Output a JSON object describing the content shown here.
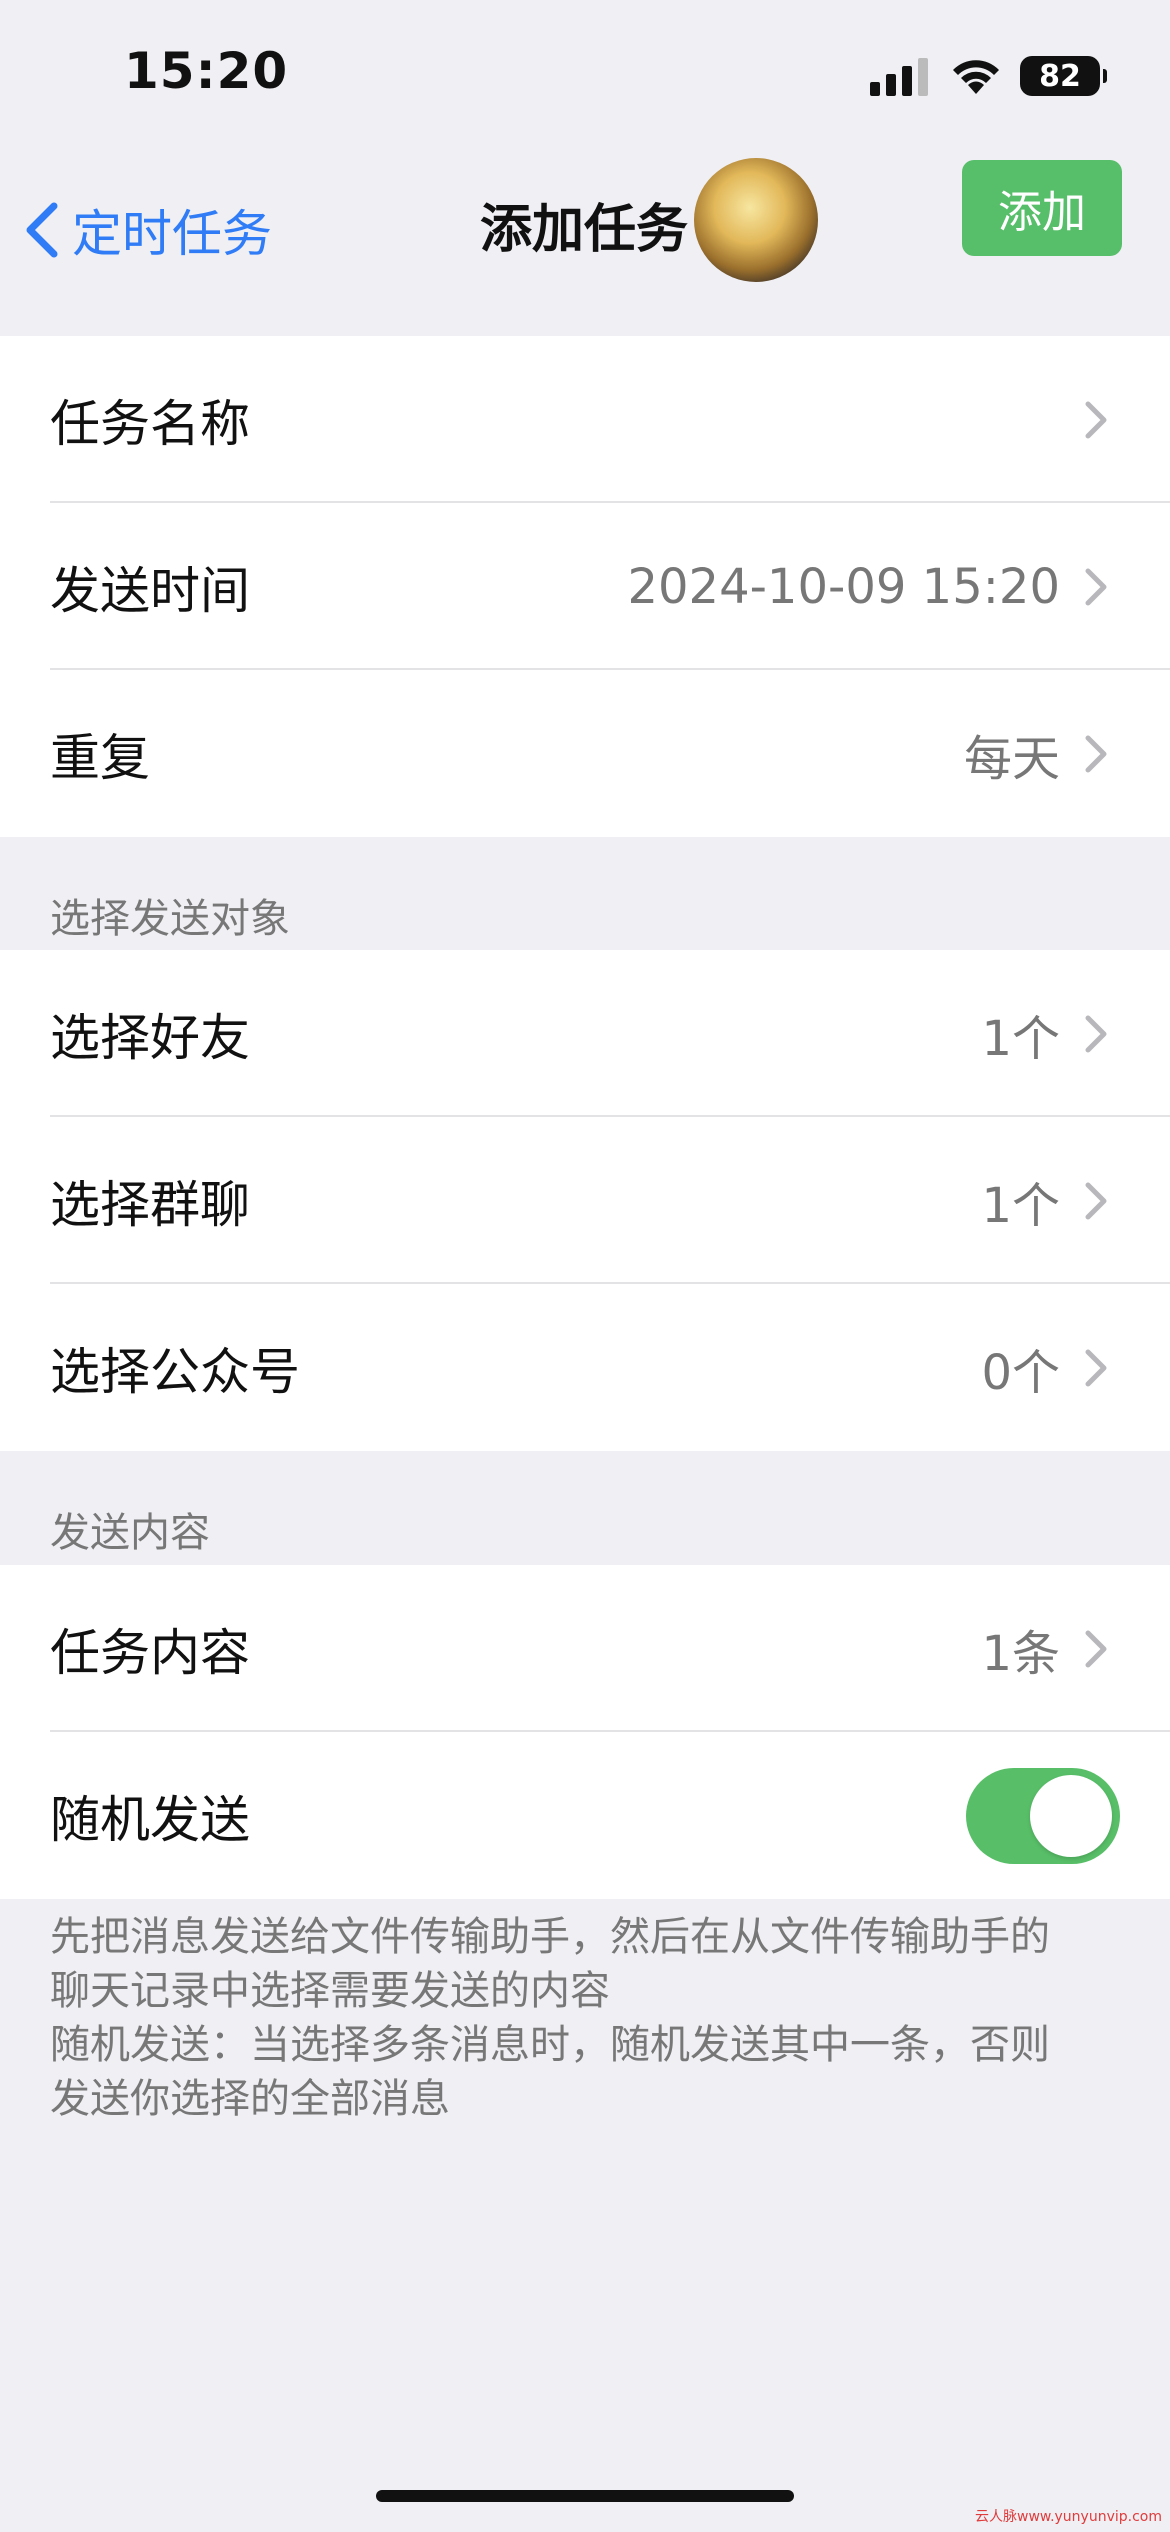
{
  "status_bar": {
    "time": "15:20",
    "battery": "82"
  },
  "nav": {
    "back_label": "定时任务",
    "title": "添加任务",
    "add_label": "添加"
  },
  "group1": [
    {
      "label": "任务名称",
      "value": ""
    },
    {
      "label": "发送时间",
      "value": "2024-10-09 15:20"
    },
    {
      "label": "重复",
      "value": "每天"
    }
  ],
  "section_targets": "选择发送对象",
  "group2": [
    {
      "label": "选择好友",
      "value": "1个"
    },
    {
      "label": "选择群聊",
      "value": "1个"
    },
    {
      "label": "选择公众号",
      "value": "0个"
    }
  ],
  "section_content": "发送内容",
  "group3": {
    "content": {
      "label": "任务内容",
      "value": "1条"
    },
    "random": {
      "label": "随机发送",
      "enabled": true
    }
  },
  "footer_lines": [
    "先把消息发送给文件传输助手，然后在从文件传输助手的",
    "聊天记录中选择需要发送的内容",
    "随机发送：当选择多条消息时，随机发送其中一条，否则",
    "发送你选择的全部消息"
  ],
  "watermark": "云人脉www.yunyunvip.com",
  "colors": {
    "accent_blue": "#2f7cf6",
    "accent_green": "#57be6a",
    "background": "#efeff4"
  }
}
